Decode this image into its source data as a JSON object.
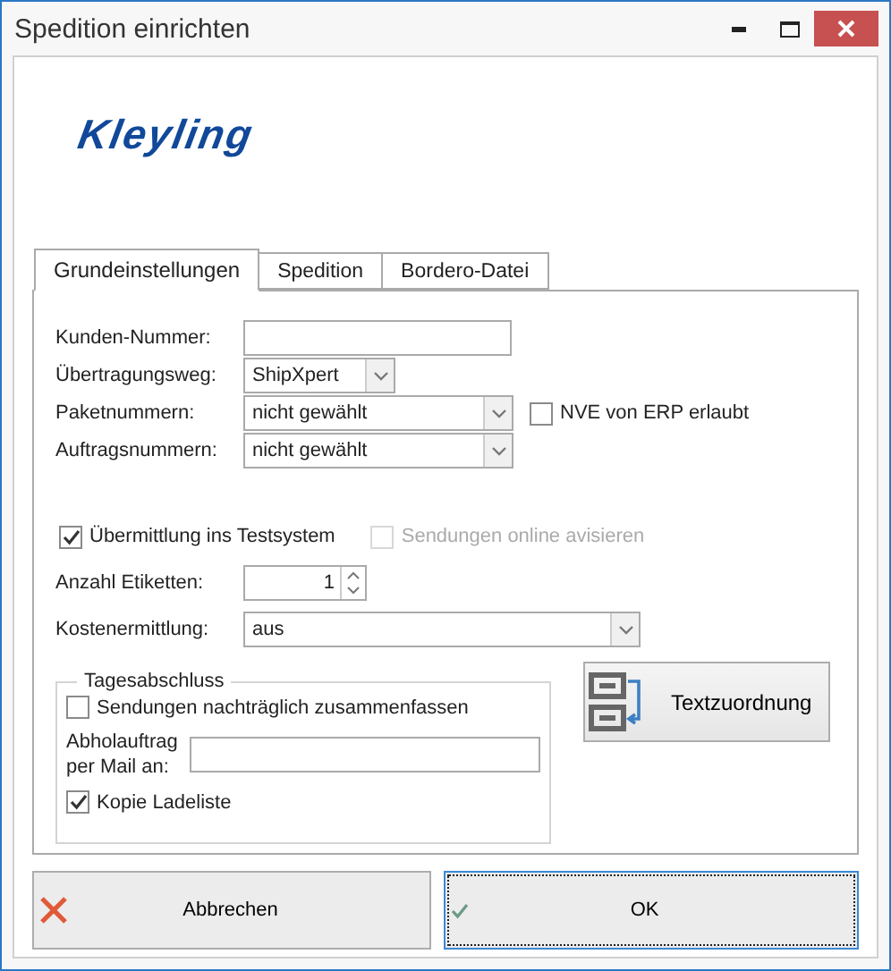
{
  "window": {
    "title": "Spedition einrichten"
  },
  "logo": "Kleyling",
  "tabs": [
    {
      "label": "Grundeinstellungen",
      "selected": true
    },
    {
      "label": "Spedition",
      "selected": false
    },
    {
      "label": "Bordero-Datei",
      "selected": false
    }
  ],
  "fields": [
    {
      "kind": "text",
      "label": "Kunden-Nummer:"
    },
    {
      "kind": "combo",
      "label": "Übertragungsweg:",
      "value": "ShipXpert"
    },
    {
      "kind": "combo",
      "label": "Paketnummern:",
      "value": "nicht gewählt",
      "checkbox": {
        "label": "NVE von ERP erlaubt",
        "checked": false,
        "disabled": false
      }
    },
    {
      "kind": "combo",
      "label": "Auftragsnummern:",
      "value": "nicht gewählt"
    }
  ],
  "options": [
    {
      "label": "Übermittlung ins Testsystem",
      "checked": true,
      "disabled": false
    },
    {
      "label": "Sendungen online avisieren",
      "checked": false,
      "disabled": true
    }
  ],
  "settings": [
    {
      "kind": "spinner",
      "label": "Anzahl Etiketten:",
      "value": "1"
    },
    {
      "kind": "combo",
      "label": "Kostenermittlung:",
      "value": "aus"
    }
  ],
  "group": {
    "title": "Tagesabschluss",
    "checkbox": {
      "label": "Sendungen nachträglich zusammenfassen",
      "checked": false,
      "disabled": false
    },
    "mail_label": "Abholauftrag\nper Mail an:",
    "checkbox_2": {
      "label": "Kopie Ladeliste",
      "checked": true,
      "disabled": false
    }
  },
  "side_button": "Textzuordnung",
  "buttons": [
    {
      "kind": "cancel",
      "label": "Abbrechen",
      "focused": false
    },
    {
      "kind": "ok",
      "label": "OK",
      "focused": true
    }
  ]
}
